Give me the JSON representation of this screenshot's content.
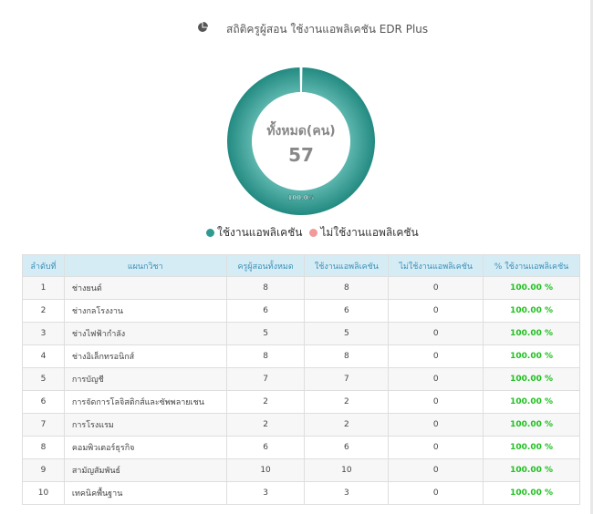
{
  "header": {
    "title": "สถิติครูผู้สอน ใช้งานแอพลิเคชัน EDR Plus",
    "icon": "pie-chart-icon"
  },
  "chart_data": {
    "type": "pie",
    "title": "สถิติครูผู้สอน ใช้งานแอพลิเคชัน EDR Plus",
    "center_label": "ทั้งหมด(คน)",
    "center_value": "57",
    "slices": [
      {
        "name": "ใช้งานแอพลิเคชัน",
        "value": 57,
        "percent_label": "100.0%",
        "color": "#2e9a91"
      },
      {
        "name": "ไม่ใช้งานแอพลิเคชัน",
        "value": 0,
        "percent_label": "",
        "color": "#f29a9a"
      }
    ],
    "legend_position": "bottom"
  },
  "table": {
    "headers": [
      "ลำดับที่",
      "แผนกวิชา",
      "ครูผู้สอนทั้งหมด",
      "ใช้งานแอพลิเคชัน",
      "ไม่ใช้งานแอพลิเคชัน",
      "% ใช้งานแอพลิเคชัน"
    ],
    "rows": [
      [
        "1",
        "ช่างยนต์",
        "8",
        "8",
        "0",
        "100.00 %"
      ],
      [
        "2",
        "ช่างกลโรงงาน",
        "6",
        "6",
        "0",
        "100.00 %"
      ],
      [
        "3",
        "ช่างไฟฟ้ากำลัง",
        "5",
        "5",
        "0",
        "100.00 %"
      ],
      [
        "4",
        "ช่างอิเล็กทรอนิกส์",
        "8",
        "8",
        "0",
        "100.00 %"
      ],
      [
        "5",
        "การบัญชี",
        "7",
        "7",
        "0",
        "100.00 %"
      ],
      [
        "6",
        "การจัดการโลจิสติกส์และซัพพลายเชน",
        "2",
        "2",
        "0",
        "100.00 %"
      ],
      [
        "7",
        "การโรงแรม",
        "2",
        "2",
        "0",
        "100.00 %"
      ],
      [
        "8",
        "คอมพิวเตอร์ธุรกิจ",
        "6",
        "6",
        "0",
        "100.00 %"
      ],
      [
        "9",
        "สามัญสัมพันธ์",
        "10",
        "10",
        "0",
        "100.00 %"
      ],
      [
        "10",
        "เทคนิคพื้นฐาน",
        "3",
        "3",
        "0",
        "100.00 %"
      ]
    ]
  },
  "colors": {
    "accent_teal": "#2e9a91",
    "accent_pink": "#f29a9a",
    "header_bg": "#d6ecf5",
    "header_text": "#3a8fb7",
    "percent_green": "#21c021"
  }
}
